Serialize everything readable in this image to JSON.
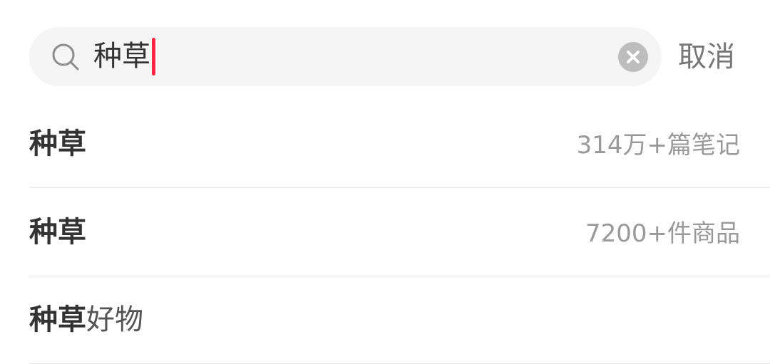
{
  "search": {
    "query": "种草",
    "cancel_label": "取消",
    "search_icon": "search-icon",
    "clear_icon": "clear-circle-icon"
  },
  "suggestions": [
    {
      "keyword": "种草",
      "rest": "",
      "meta": "314万+篇笔记"
    },
    {
      "keyword": "种草",
      "rest": "",
      "meta": "7200+件商品"
    },
    {
      "keyword": "种草",
      "rest": "好物",
      "meta": ""
    }
  ],
  "colors": {
    "caret": "#ff2442",
    "search_bg": "#f5f5f5",
    "muted_text": "#999999"
  }
}
